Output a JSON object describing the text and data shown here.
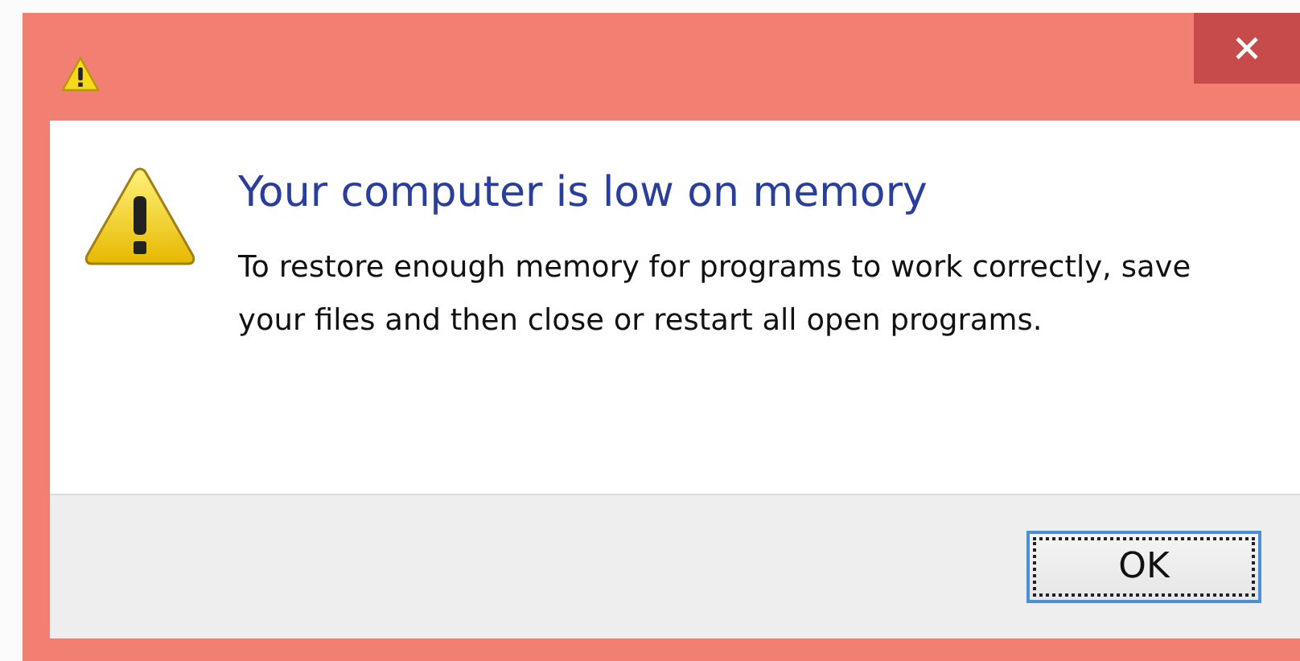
{
  "dialog": {
    "heading": "Your computer is low on memory",
    "message": "To restore enough memory for programs to work correctly, save your files and then close or restart all open programs.",
    "buttons": [
      {
        "label": "OK",
        "focused": true
      }
    ]
  }
}
